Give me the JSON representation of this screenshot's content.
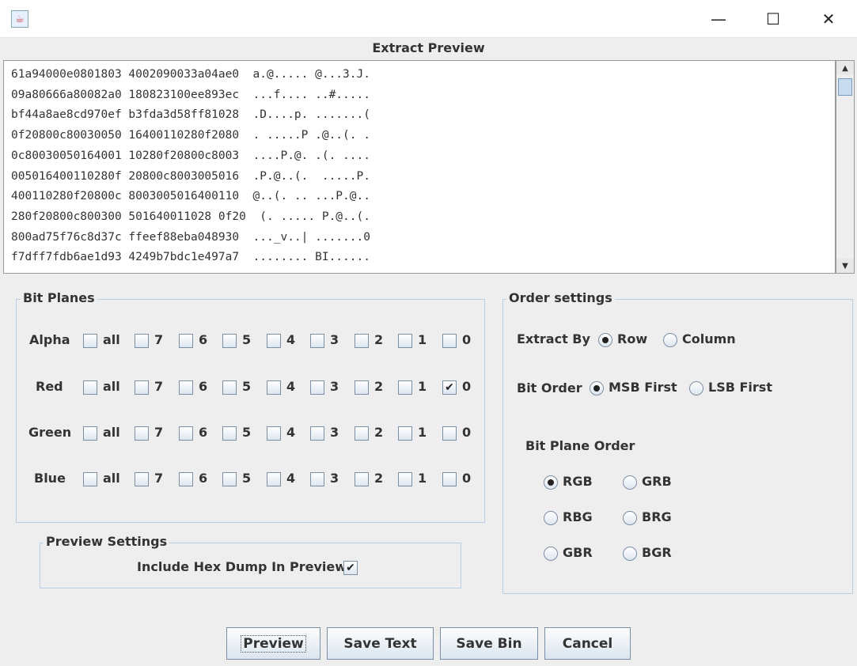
{
  "window": {
    "minimize": "—",
    "maximize": "☐",
    "close": "✕"
  },
  "preview": {
    "title": "Extract Preview",
    "lines": [
      "61a94000e0801803 4002090033a04ae0  a.@..... @...3.J.",
      "09a80666a80082a0 180823100ee893ec  ...f.... ..#.....",
      "bf44a8ae8cd970ef b3fda3d58ff81028  .D....p. .......(",
      "0f20800c80030050 16400110280f2080  . .....P .@..(. .",
      "0c80030050164001 10280f20800c8003  ....P.@. .(. ....",
      "005016400110280f 20800c8003005016  .P.@..(.  .....P.",
      "400110280f20800c 8003005016400110  @..(. .. ...P.@..",
      "280f20800c800300 501640011028 0f20  (. ..... P.@..(.",
      "800ad75f76c8d37c ffeef88eba048930  ..._v..| .......0",
      "f7dff7fdb6ae1d93 4249b7bdc1e497a7  ........ BI......"
    ]
  },
  "bit_planes": {
    "title": "Bit Planes",
    "bits": [
      "all",
      "7",
      "6",
      "5",
      "4",
      "3",
      "2",
      "1",
      "0"
    ],
    "channels": [
      {
        "name": "Alpha",
        "checked": []
      },
      {
        "name": "Red",
        "checked": [
          "0"
        ]
      },
      {
        "name": "Green",
        "checked": []
      },
      {
        "name": "Blue",
        "checked": []
      }
    ]
  },
  "preview_settings": {
    "title": "Preview Settings",
    "hex_dump_label": "Include Hex Dump In Preview",
    "hex_dump_checked": true
  },
  "order": {
    "title": "Order settings",
    "extract_by": {
      "label": "Extract By",
      "options": [
        "Row",
        "Column"
      ],
      "selected": "Row"
    },
    "bit_order": {
      "label": "Bit Order",
      "options": [
        "MSB First",
        "LSB First"
      ],
      "selected": "MSB First"
    },
    "plane_order": {
      "label": "Bit Plane Order",
      "options": [
        "RGB",
        "GRB",
        "RBG",
        "BRG",
        "GBR",
        "BGR"
      ],
      "selected": "RGB"
    }
  },
  "buttons": {
    "preview": "Preview",
    "save_text": "Save Text",
    "save_bin": "Save Bin",
    "cancel": "Cancel"
  }
}
